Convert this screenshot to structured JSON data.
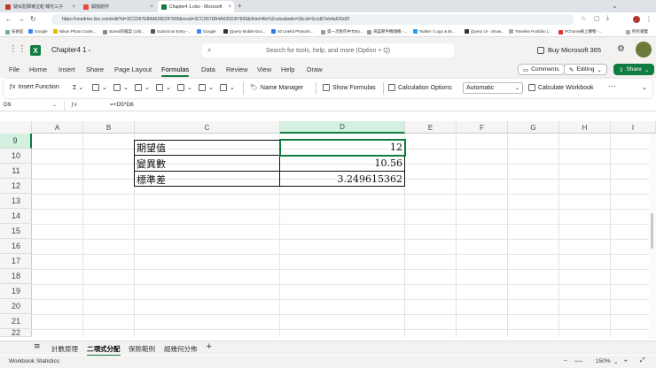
{
  "browser": {
    "tabs": [
      {
        "label": "疑似犯罪被泣蛇 曝光三子",
        "color": "#c0392b"
      },
      {
        "label": "開放創作",
        "color": "#e74c3c"
      },
      {
        "label": "Chapter4 1.xlsx - Microsoft",
        "color": "#107c41"
      }
    ],
    "url": "https://onedrive.live.com/edit?id=3CCD67EB4A626D2F!900&resid=3CCD67EB4A626D2F!900&ithint=file%2cxlsx&wdo=2&cid=3ccd67eb4a626d2f",
    "bookmarks": [
      "技術區",
      "Google",
      "Nikon Photo Conte...",
      "stored的檔案 (1/8)...",
      "Submit an Entry -...",
      "Google",
      "jQuery Mobile Doc...",
      "40 Useful Photosh...",
      "第一次製作中文Bo...",
      "海棠節手機隨機 -...",
      "Twitter / Logo & Br...",
      "jQuery UI - Show...",
      "Timeline Portfolio |...",
      "PChome線上購物 -...",
      "所有書籤"
    ]
  },
  "excel": {
    "file_name": "Chapter4 1",
    "search_placeholder": "Search for tools, help, and more (Option + Q)",
    "buy": "Buy Microsoft 365",
    "menu_tabs": [
      "File",
      "Home",
      "Insert",
      "Share",
      "Page Layout",
      "Formulas",
      "Data",
      "Review",
      "View",
      "Help",
      "Draw"
    ],
    "active_tab": "Formulas",
    "comments": "Comments",
    "editing": "Editing",
    "share": "Share",
    "ribbon": {
      "insert_function": "Insert Function",
      "name_manager": "Name Manager",
      "show_formulas": "Show Formulas",
      "calc_options": "Calculation Options",
      "calc_mode": "Automatic",
      "calc_workbook": "Calculate Workbook",
      "more": "···"
    },
    "name_box": "D9",
    "formula": "=+D5*D6",
    "columns": [
      "A",
      "B",
      "C",
      "D",
      "E",
      "F",
      "G",
      "H",
      "I"
    ],
    "selected_column": "D",
    "rows": [
      "9",
      "10",
      "11",
      "12",
      "13",
      "14",
      "15",
      "16",
      "17",
      "18",
      "19",
      "20",
      "21",
      "22"
    ],
    "selected_row": "9",
    "table": [
      {
        "label": "期望值",
        "value": "12"
      },
      {
        "label": "變異數",
        "value": "10.56"
      },
      {
        "label": "標準差",
        "value": "3.249615362"
      }
    ],
    "sheets": [
      "計數原理",
      "二項式分配",
      "保險範例",
      "超幾何分佈"
    ],
    "active_sheet": "二項式分配",
    "add_sheet": "+",
    "status": "Workbook Statistics",
    "zoom": "150%"
  }
}
